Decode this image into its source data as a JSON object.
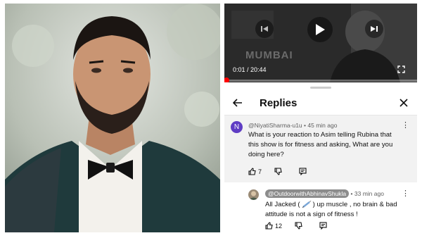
{
  "video": {
    "overlay_text": "MUMBAI",
    "time": "0:01 / 20:44",
    "progress_fraction": 0.0008
  },
  "replies": {
    "title": "Replies",
    "comments": [
      {
        "avatar_letter": "N",
        "handle": "@NiyatiSharma-u1u",
        "time": "45 min ago",
        "text": "What is your reaction to Asim telling Rubina that this show is for fitness and asking, What are you doing here?",
        "likes": "7"
      },
      {
        "handle": "@OutdoorwithAbhinavShukla",
        "time": "33 min ago",
        "text_before": "All Jacked (",
        "text_after": ") up muscle , no brain & bad attitude is not a sign of fitness !",
        "likes": "12"
      }
    ]
  },
  "colors": {
    "accent": "#ff0000",
    "avatar_n": "#5f3dc4"
  }
}
